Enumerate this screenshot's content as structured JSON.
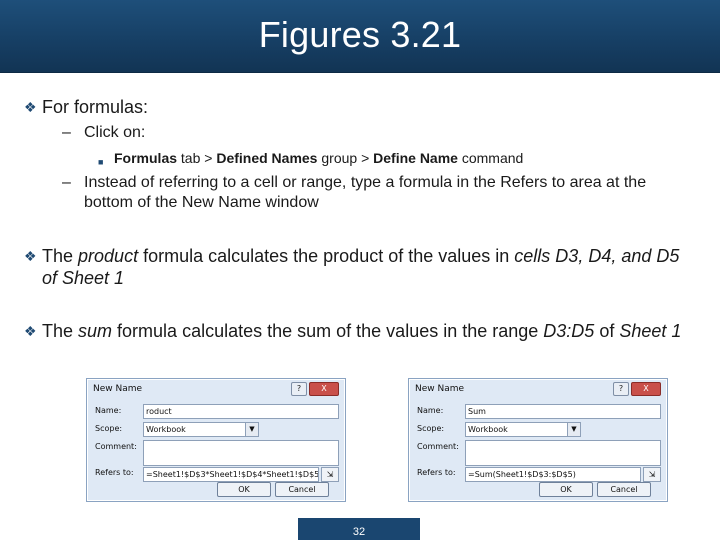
{
  "slide": {
    "title": "Figures 3.21",
    "page_number": "32"
  },
  "content": {
    "b1": {
      "text": "For formulas:"
    },
    "b1_sub1": {
      "dash": "–",
      "text": "Click on:"
    },
    "b1_sub1_item": {
      "p1": "Formulas",
      "p2": " tab > ",
      "p3": "Defined Names",
      "p4": " group > ",
      "p5": "Define Name",
      "p6": " command"
    },
    "b1_sub2": {
      "dash": "–",
      "text": "Instead of referring to a cell or range, type a formula in the Refers to area at the bottom of the New Name window"
    },
    "b2": {
      "p1": "The ",
      "p2": "product",
      "p3": " formula calculates the product of the values in ",
      "p4": "cells D3, D4, and D5 of Sheet 1"
    },
    "b3": {
      "p1": "The ",
      "p2": "sum",
      "p3": " formula calculates the sum of the values in the range ",
      "p4": "D3:D5",
      "p5": " of ",
      "p6": "Sheet 1"
    }
  },
  "dialog_left": {
    "title": "New Name",
    "help": "?",
    "close": "X",
    "name_label": "Name:",
    "name_value": "roduct",
    "scope_label": "Scope:",
    "scope_value": "Workbook",
    "comment_label": "Comment:",
    "refers_label": "Refers to:",
    "refers_value": "=Sheet1!$D$3*Sheet1!$D$4*Sheet1!$D$5",
    "ok": "OK",
    "cancel": "Cancel"
  },
  "dialog_right": {
    "title": "New Name",
    "help": "?",
    "close": "X",
    "name_label": "Name:",
    "name_value": "Sum",
    "scope_label": "Scope:",
    "scope_value": "Workbook",
    "comment_label": "Comment:",
    "refers_label": "Refers to:",
    "refers_value": "=Sum(Sheet1!$D$3:$D$5)",
    "ok": "OK",
    "cancel": "Cancel"
  }
}
